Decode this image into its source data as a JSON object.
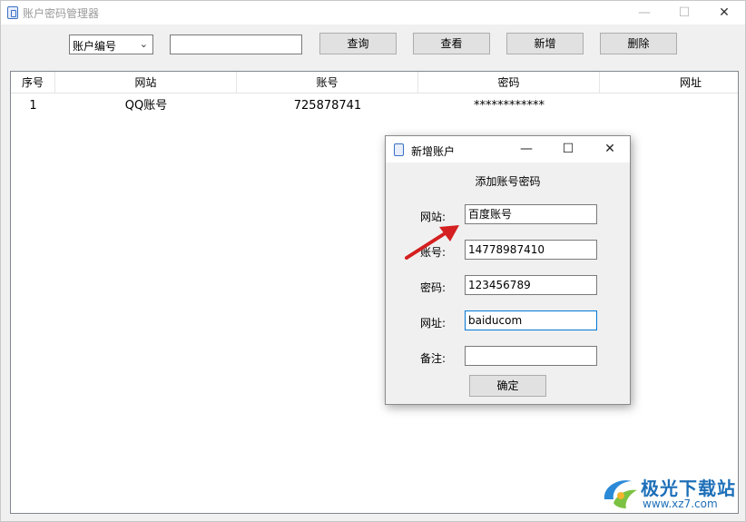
{
  "window": {
    "title": "账户密码管理器",
    "minimize": "—",
    "maximize": "☐",
    "close": "✕"
  },
  "toolbar": {
    "filter_select": "账户编号",
    "search_value": "",
    "query_label": "查询",
    "view_label": "查看",
    "add_label": "新增",
    "delete_label": "删除"
  },
  "table": {
    "columns": [
      "序号",
      "网站",
      "账号",
      "密码",
      "网址"
    ],
    "rows": [
      [
        "1",
        "QQ账号",
        "725878741",
        "************",
        ""
      ]
    ]
  },
  "dialog": {
    "title": "新增账户",
    "heading": "添加账号密码",
    "minimize": "—",
    "maximize": "☐",
    "close": "✕",
    "fields": [
      {
        "label": "网站:",
        "value": "百度账号"
      },
      {
        "label": "账号:",
        "value": "14778987410"
      },
      {
        "label": "密码:",
        "value": "123456789"
      },
      {
        "label": "网址:",
        "value": "baiducom"
      },
      {
        "label": "备注:",
        "value": ""
      }
    ],
    "ok_label": "确定"
  },
  "watermark": {
    "text": "极光下载站",
    "url": "www.xz7.com"
  },
  "colors": {
    "accent": "#0078d7",
    "arrow": "#d42020",
    "watermark": "#1d6fb8"
  }
}
